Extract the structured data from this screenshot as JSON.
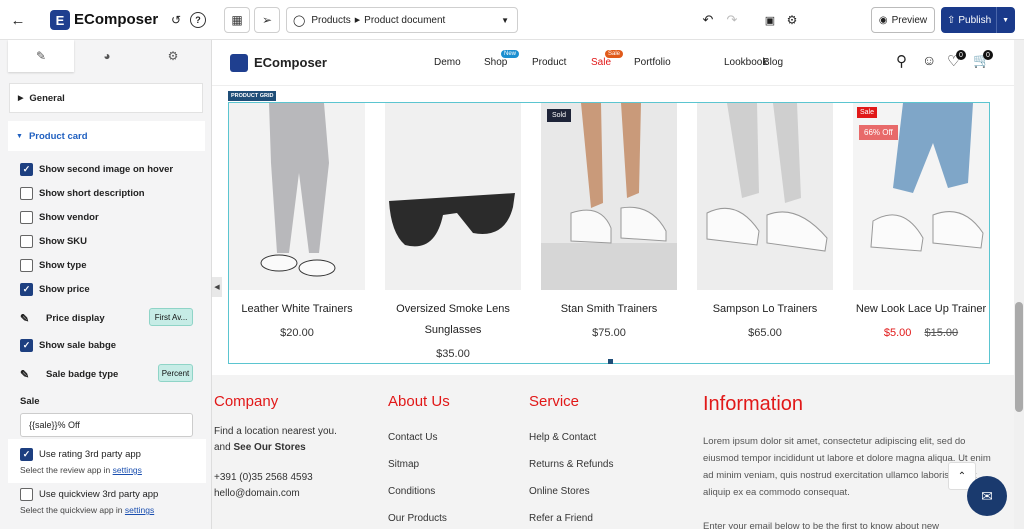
{
  "topbar": {
    "app_name": "EComposer",
    "breadcrumb": {
      "section": "Products",
      "page": "Product document"
    },
    "preview_label": "Preview",
    "publish_label": "Publish"
  },
  "sidebar": {
    "sections": {
      "general": "General",
      "product_card": "Product card"
    },
    "options": [
      {
        "label": "Show second image on hover",
        "checked": true
      },
      {
        "label": "Show short description",
        "checked": false
      },
      {
        "label": "Show vendor",
        "checked": false
      },
      {
        "label": "Show SKU",
        "checked": false
      },
      {
        "label": "Show type",
        "checked": false
      },
      {
        "label": "Show price",
        "checked": true
      }
    ],
    "price_display": {
      "label": "Price display",
      "value": "First Av..."
    },
    "show_sale_badge": {
      "label": "Show sale babge",
      "checked": true
    },
    "sale_badge_type": {
      "label": "Sale badge type",
      "value": "Percent"
    },
    "sale": {
      "label": "Sale",
      "value": "{{sale}}% Off"
    },
    "rating": {
      "label": "Use rating 3rd party app",
      "checked": true,
      "hint": "Select the review app in ",
      "link": "settings"
    },
    "quickview": {
      "label": "Use quickview 3rd party app",
      "checked": false,
      "hint": "Select the quickview app in ",
      "link": "settings"
    }
  },
  "store": {
    "logo": "EComposer",
    "nav": [
      {
        "label": "Demo"
      },
      {
        "label": "Shop",
        "badge": "New",
        "badge_color": "#1c8fd0"
      },
      {
        "label": "Product"
      },
      {
        "label": "Sale",
        "badge": "Sale",
        "badge_color": "#e05a1a",
        "color": "#e11818"
      },
      {
        "label": "Portfolio"
      },
      {
        "label": "Lookbook"
      },
      {
        "label": "Blog"
      }
    ],
    "cart_count": "0",
    "wish_count": "0",
    "grid_tag": "PRODUCT GRID",
    "products": [
      {
        "title": "Leather White Trainers",
        "price": "$20.00",
        "compare": ""
      },
      {
        "title": "Oversized Smoke Lens Sunglasses",
        "price": "$35.00",
        "compare": ""
      },
      {
        "title": "Stan Smith Trainers",
        "price": "$75.00",
        "compare": "",
        "tag": "Sold"
      },
      {
        "title": "Sampson Lo Trainers",
        "price": "$65.00",
        "compare": ""
      },
      {
        "title": "New Look Lace Up Trainer",
        "price": "$5.00",
        "compare": "$15.00",
        "tag": "Sale",
        "tag2": "66% Off"
      }
    ]
  },
  "footer": {
    "company": {
      "title": "Company",
      "lines": [
        "Find a location nearest you.",
        "and ",
        "See Our Stores",
        "+391 (0)35 2568 4593",
        "hello@domain.com"
      ]
    },
    "about": {
      "title": "About Us",
      "links": [
        "Contact Us",
        "Sitmap",
        "Conditions",
        "Our Products"
      ]
    },
    "service": {
      "title": "Service",
      "links": [
        "Help & Contact",
        "Returns & Refunds",
        "Online Stores",
        "Refer a Friend"
      ]
    },
    "info": {
      "title": "Information",
      "text": "Lorem ipsum dolor sit amet, consectetur adipiscing elit, sed do eiusmod tempor incididunt ut labore et dolore magna aliqua. Ut enim ad minim veniam, quis nostrud exercitation ullamco laboris nisi ut aliquip ex ea commodo consequat.",
      "text2": "Enter your email below to be the first to know about new"
    }
  }
}
